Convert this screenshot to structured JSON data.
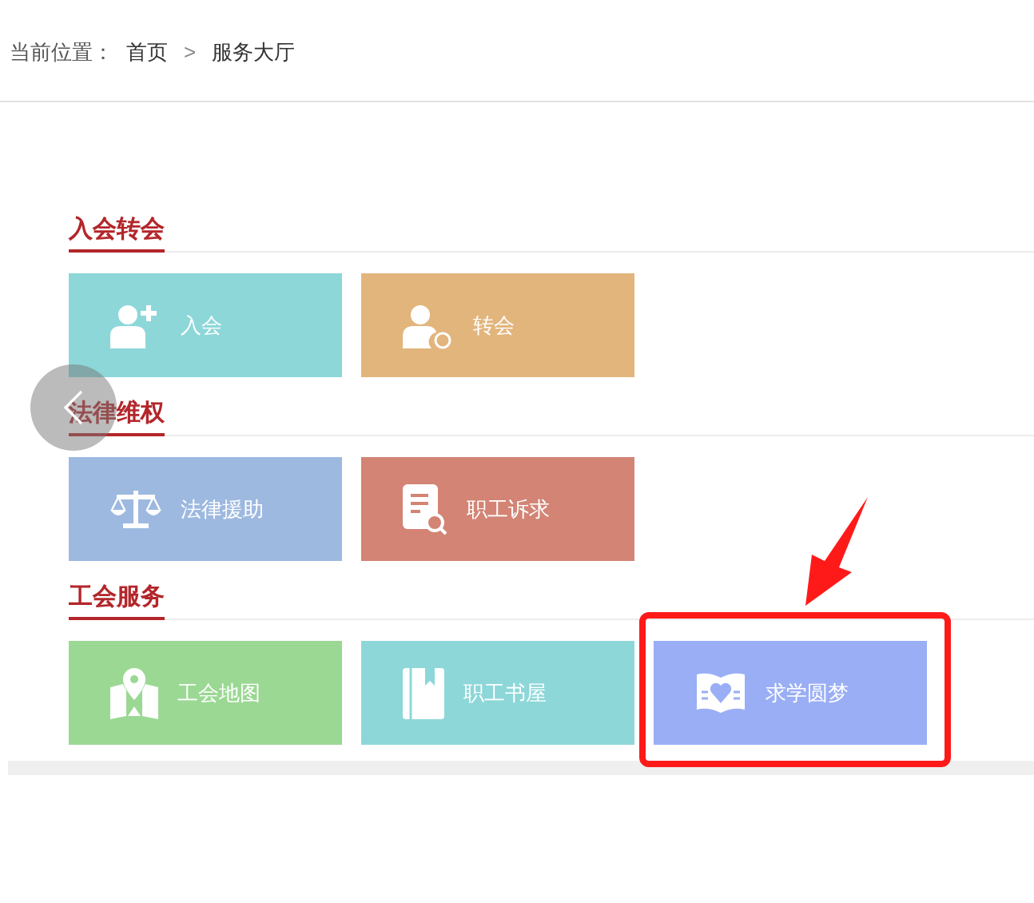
{
  "breadcrumb": {
    "label": "当前位置：",
    "items": [
      "首页",
      "服务大厅"
    ],
    "separator": ">"
  },
  "sections": [
    {
      "title": "入会转会",
      "tiles": [
        {
          "label": "入会",
          "color": "#8dd7d9",
          "highlighted": false
        },
        {
          "label": "转会",
          "color": "#e2b57d",
          "highlighted": false
        }
      ]
    },
    {
      "title": "法律维权",
      "tiles": [
        {
          "label": "法律援助",
          "color": "#9db9e0",
          "highlighted": false
        },
        {
          "label": "职工诉求",
          "color": "#d38474",
          "highlighted": false
        }
      ]
    },
    {
      "title": "工会服务",
      "tiles": [
        {
          "label": "工会地图",
          "color": "#9bd893",
          "highlighted": false
        },
        {
          "label": "职工书屋",
          "color": "#8dd7d9",
          "highlighted": false
        },
        {
          "label": "求学圆梦",
          "color": "#9aaef5",
          "highlighted": true
        }
      ]
    }
  ]
}
